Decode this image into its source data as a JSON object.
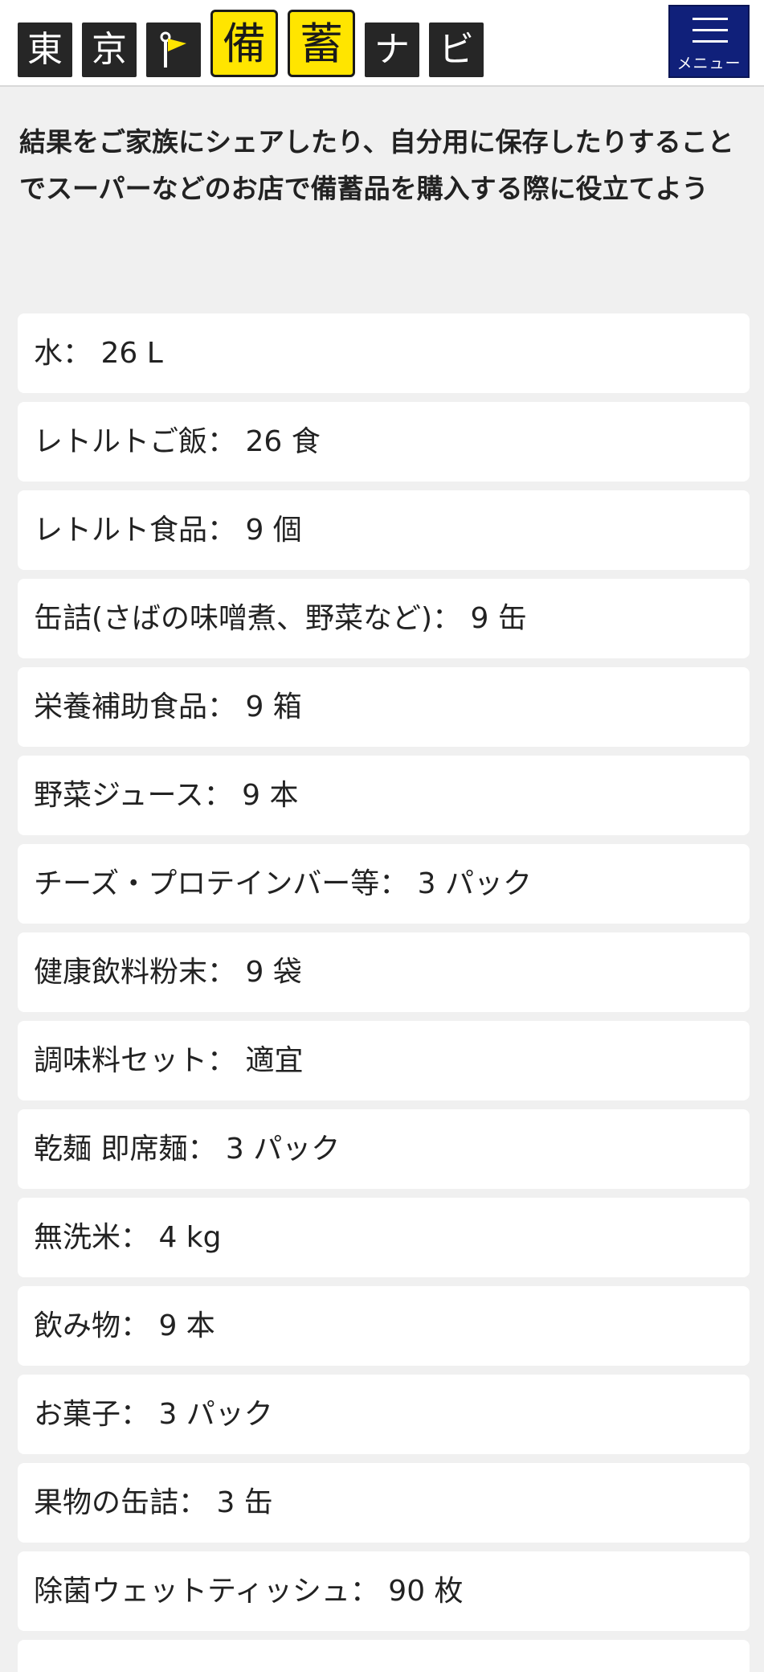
{
  "header": {
    "logo": {
      "tile1": "東",
      "tile2": "京",
      "tile4": "備",
      "tile5": "蓄",
      "tile6": "ナ",
      "tile7": "ビ"
    },
    "menu_label": "メニュー",
    "menu_color": "#10207a",
    "accent_yellow": "#ffe500"
  },
  "intro_text": "結果をご家族にシェアしたり、自分用に保存したりすることでスーパーなどのお店で備蓄品を購入する際に役立てよう",
  "items": [
    "水： 26 L",
    "レトルトご飯： 26 食",
    "レトルト食品： 9 個",
    "缶詰(さばの味噌煮、野菜など)： 9 缶",
    "栄養補助食品： 9 箱",
    "野菜ジュース： 9 本",
    "チーズ・プロテインバー等： 3 パック",
    "健康飲料粉末： 9 袋",
    "調味料セット： 適宜",
    "乾麺 即席麺： 3 パック",
    "無洗米： 4 kg",
    "飲み物： 9 本",
    "お菓子： 3 パック",
    "果物の缶詰： 3 缶",
    "除菌ウェットティッシュ： 90 枚"
  ]
}
